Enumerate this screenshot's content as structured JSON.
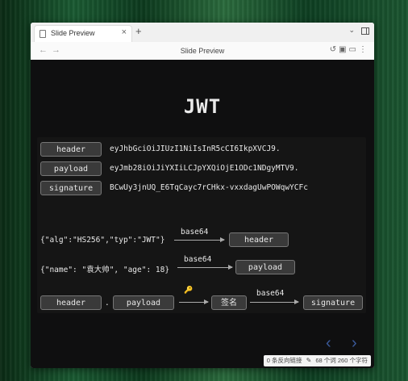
{
  "tab": {
    "label": "Slide Preview",
    "close": "×",
    "new": "+"
  },
  "address": {
    "title": "Slide Preview"
  },
  "slide": {
    "title": "JWT",
    "rows": [
      {
        "label": "header",
        "value": "eyJhbGciOiJIUzI1NiIsInR5cCI6IkpXVCJ9."
      },
      {
        "label": "payload",
        "value": "eyJmb28iOiJiYXIiLCJpYXQiOjE1ODc1NDgyMTV9."
      },
      {
        "label": "signature",
        "value": "BCwUy3jnUQ_E6TqCayc7rCHkx-vxxdagUwPOWqwYCFc"
      }
    ],
    "flow1": {
      "input": "{\"alg\":\"HS256\",\"typ\":\"JWT\"}",
      "arrow": "base64",
      "output": "header"
    },
    "flow2": {
      "input": "{\"name\": \"袁大帅\", \"age\": 18}",
      "arrow": "base64",
      "output": "payload"
    },
    "flow3": {
      "a": "header",
      "dot": ".",
      "b": "payload",
      "sign": "签名",
      "arrow": "base64",
      "output": "signature"
    }
  },
  "status": {
    "backlinks": "0 条反向链接",
    "words": "68 个词",
    "chars": "260 个字符"
  },
  "icons": [
    "page-icon",
    "key-icon",
    "edit-icon",
    "chevron-left-icon",
    "chevron-right-icon"
  ]
}
